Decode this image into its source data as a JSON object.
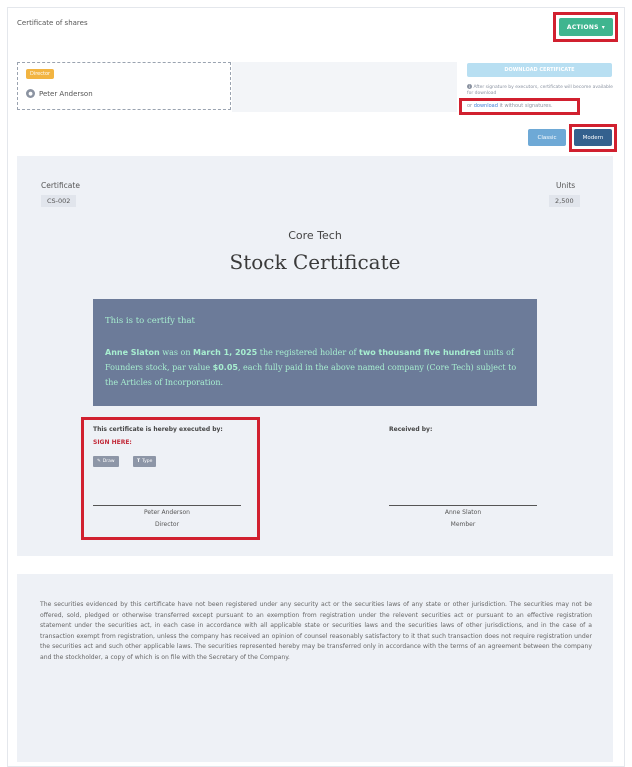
{
  "page": {
    "title": "Certificate of shares"
  },
  "toolbar": {
    "actions_label": "ACTIONS",
    "actions_caret": "▾"
  },
  "signer": {
    "role_tag": "Director",
    "name": "Peter Anderson",
    "avatar_glyph": "●"
  },
  "download": {
    "button_label": "DOWNLOAD CERTIFICATE",
    "info_text": "After signature by executors, certificate will become available for download",
    "link_prefix": "or",
    "link_label": "download",
    "link_suffix": "it without signatures."
  },
  "view_toggle": {
    "classic_label": "Classic",
    "modern_label": "Modern"
  },
  "certificate": {
    "certificate_label": "Certificate",
    "certificate_id": "CS-002",
    "units_label": "Units",
    "units_value": "2,500",
    "company": "Core Tech",
    "title": "Stock Certificate",
    "certify_intro": "This is to certify that",
    "holder": "Anne Slaton",
    "text_was_on": "was on",
    "date": "March 1, 2025",
    "text_registered": "the registered holder of",
    "units_words": "two thousand five hundred",
    "text_units_of": "units of Founders stock, par value",
    "par_value": "$0.05",
    "text_rest": ", each fully paid in the above named company (Core Tech) subject to the Articles of Incorporation."
  },
  "signatures": {
    "executed_label": "This certificate is hereby executed by:",
    "sign_here": "SIGN HERE:",
    "draw_label": "Draw",
    "type_label": "Type",
    "signer_name": "Peter Anderson",
    "signer_role": "Director",
    "received_label": "Received by:",
    "receiver_name": "Anne Slaton",
    "receiver_role": "Member"
  },
  "legend": {
    "text": "The securities evidenced by this certificate have not been registered under any security act or the securities laws of any state or other jurisdiction. The securities may not be offered, sold, pledged or otherwise transferred except pursuant to an exemption from registration under the relevent securities act or pursuant to an effective registration statement under the securities act, in each case in accordance with all applicable state or securities laws and the securities laws of other jurisdictions, and in the case of a transaction exempt from registration, unless the company has received an opinion of counsel reasonably satisfactory to it that such transaction does not require registration under the securities act and such other applicable laws. The securities represented hereby may be transferred only in accordance with the terms of an agreement between the company and the stockholder, a copy of which is on file with the Secretary of the Company."
  },
  "colors": {
    "highlight": "#d1202f",
    "actions_button": "#3fb58f",
    "modern_button": "#34618e",
    "certify_box": "#6c7b99",
    "certify_text": "#a7eed0"
  }
}
